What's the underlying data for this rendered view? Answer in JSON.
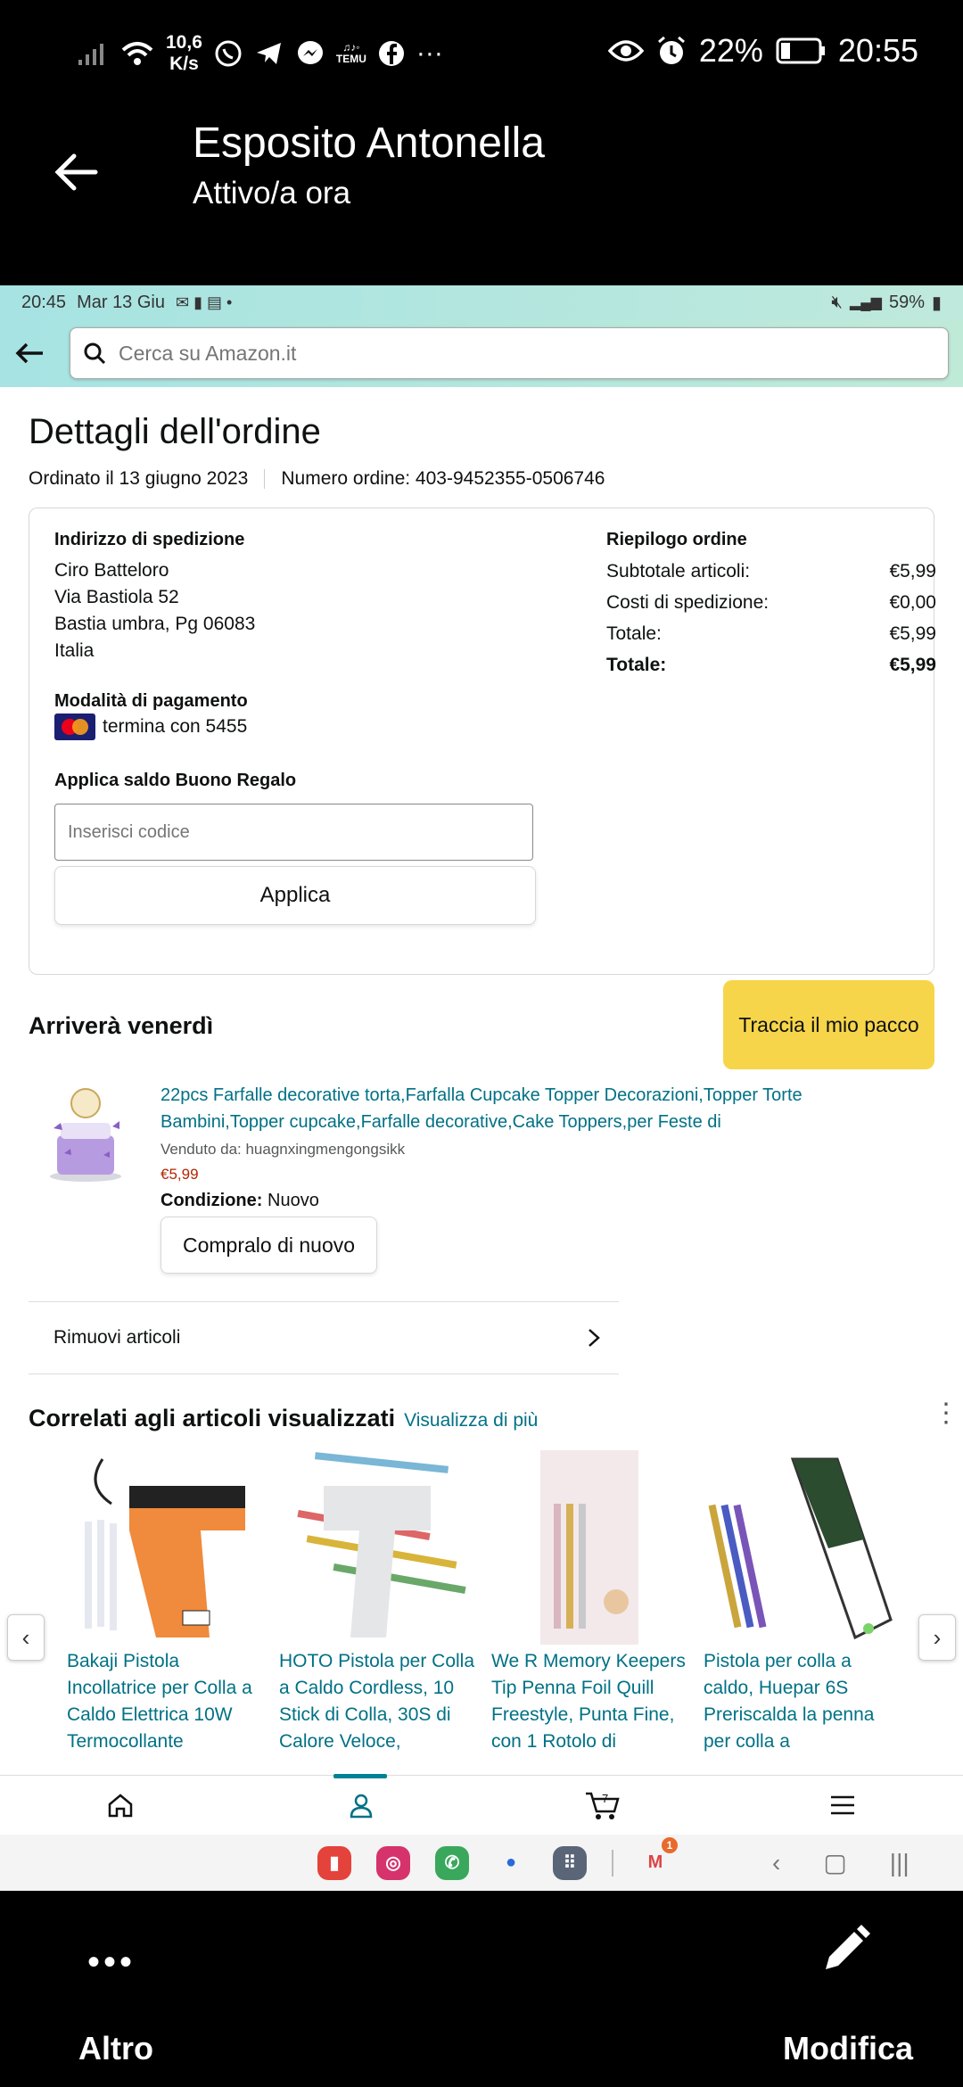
{
  "outer_status": {
    "netspeed_value": "10,6",
    "netspeed_unit": "K/s",
    "battery": "22%",
    "time": "20:55",
    "extra_app_label": "TEMU"
  },
  "chat": {
    "name": "Esposito Antonella",
    "status": "Attivo/a ora"
  },
  "inner_status": {
    "time": "20:45",
    "date": "Mar 13 Giu",
    "battery": "59%"
  },
  "search": {
    "placeholder": "Cerca su Amazon.it"
  },
  "order": {
    "title": "Dettagli dell'ordine",
    "ordered_on": "Ordinato il 13 giugno 2023",
    "order_number": "Numero ordine: 403-9452355-0506746"
  },
  "shipping": {
    "label": "Indirizzo di spedizione",
    "lines": [
      "Ciro Batteloro",
      "Via Bastiola 52",
      "Bastia umbra, Pg 06083",
      "Italia"
    ]
  },
  "payment": {
    "label": "Modalità di pagamento",
    "card_text": "termina con 5455",
    "card_brand": "MasterCard"
  },
  "gift": {
    "label": "Applica saldo Buono Regalo",
    "placeholder": "Inserisci codice",
    "button": "Applica"
  },
  "summary": {
    "label": "Riepilogo ordine",
    "rows": [
      {
        "label": "Subtotale articoli:",
        "value": "€5,99"
      },
      {
        "label": "Costi di spedizione:",
        "value": "€0,00"
      },
      {
        "label": "Totale:",
        "value": "€5,99"
      },
      {
        "label": "Totale:",
        "value": "€5,99"
      }
    ]
  },
  "delivery": {
    "title": "Arriverà venerdì",
    "track_button": "Traccia il mio pacco"
  },
  "product": {
    "title": "22pcs Farfalle decorative torta,Farfalla Cupcake Topper Decorazioni,Topper Torte Bambini,Topper cupcake,Farfalle decorative,Cake Toppers,per Feste di",
    "seller": "Venduto da: huagnxingmengongsikk",
    "price": "€5,99",
    "condition_label": "Condizione:",
    "condition_value": "Nuovo",
    "buy_again": "Compralo di nuovo"
  },
  "remove": {
    "label": "Rimuovi articoli"
  },
  "related": {
    "title": "Correlati agli articoli visualizzati",
    "more": "Visualizza di più",
    "items": [
      {
        "title": "Bakaji Pistola Incollatrice per Colla a Caldo Elettrica 10W Termocollante"
      },
      {
        "title": "HOTO Pistola per Colla a Caldo Cordless, 10 Stick di Colla, 30S di Calore Veloce,"
      },
      {
        "title": "We R Memory Keepers Tip Penna Foil Quill Freestyle, Punta Fine, con 1 Rotolo di"
      },
      {
        "title": "Pistola per colla a caldo, Huepar 6S Preriscalda la penna per colla a"
      }
    ]
  },
  "samsung": {
    "gmail_badge": "1"
  },
  "outer_bottom": {
    "more": "Altro",
    "edit": "Modifica"
  },
  "colors": {
    "link": "#007185",
    "track_button": "#f7d54a",
    "price": "#b12704",
    "header_gradient": "#a6e3e2"
  }
}
